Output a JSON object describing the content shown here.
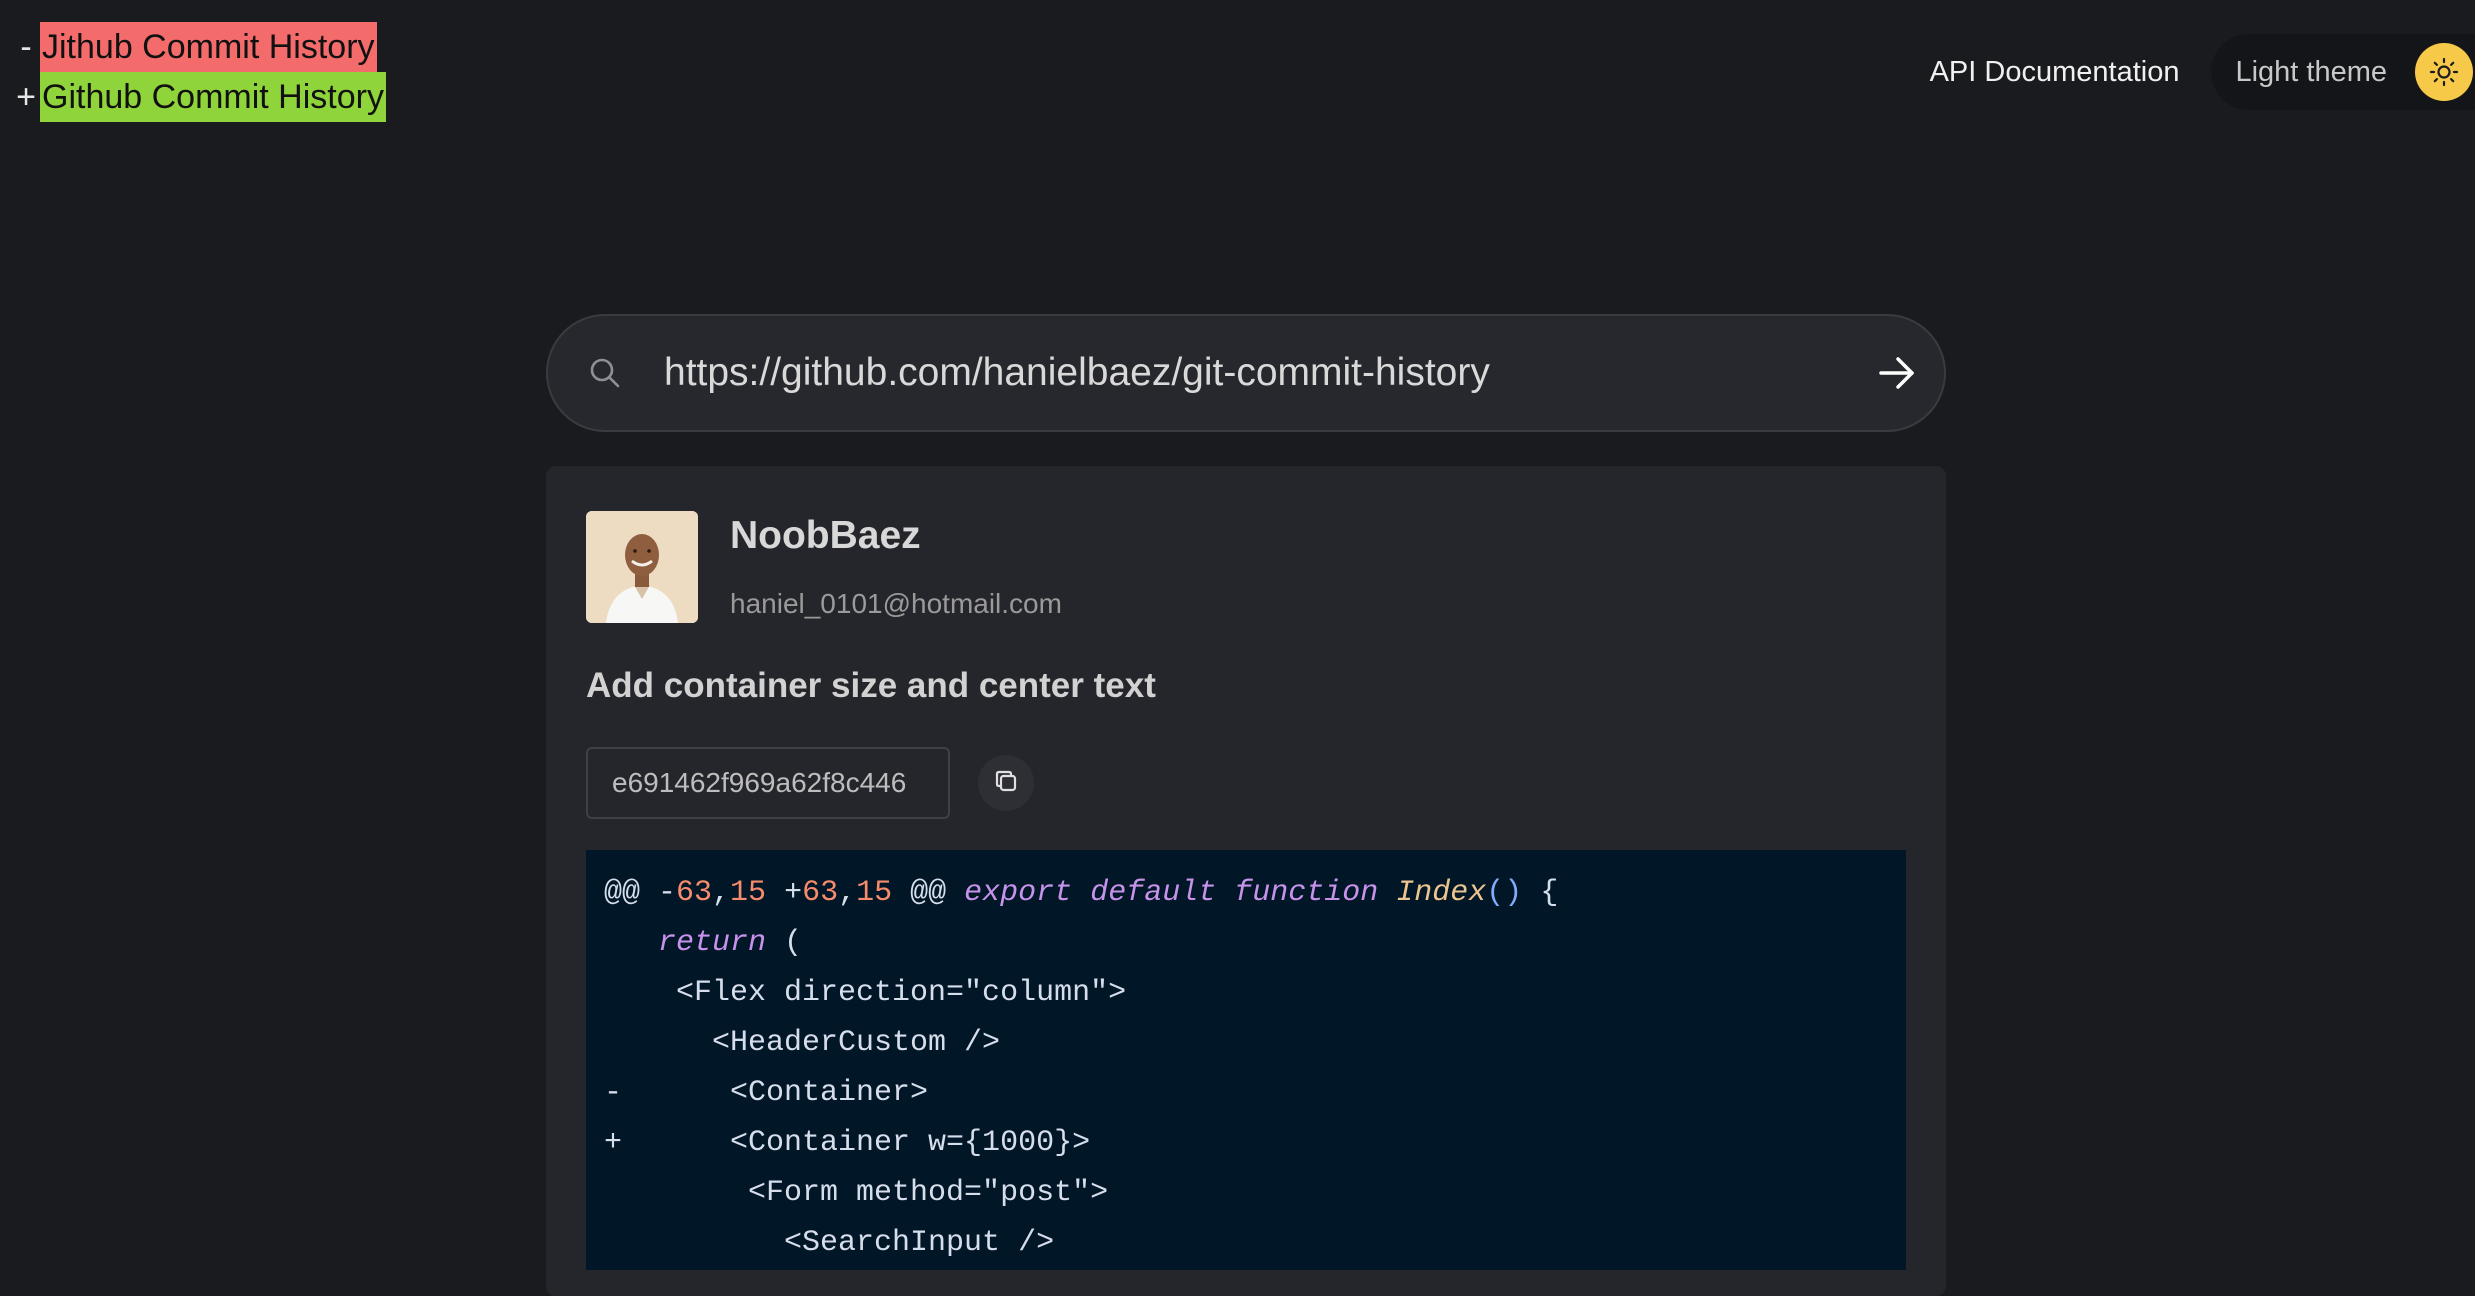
{
  "page_title": {
    "removed": "Jithub Commit History",
    "added": "Github Commit History",
    "minus_sign": "-",
    "plus_sign": "+"
  },
  "header": {
    "api_docs_label": "API Documentation",
    "theme_toggle_label": "Light theme",
    "theme_icon": "sun-icon"
  },
  "search": {
    "value": "https://github.com/hanielbaez/git-commit-history",
    "search_icon": "search-icon",
    "submit_icon": "arrow-right-icon"
  },
  "commit": {
    "author_name": "NoobBaez",
    "author_email": "haniel_0101@hotmail.com",
    "message": "Add container size and center text",
    "sha": "e691462f969a62f8c446",
    "copy_icon": "copy-icon",
    "diff": {
      "hunk_header": {
        "prefix": "@@ -",
        "old_start": "63",
        "comma1": ",",
        "old_len": "15",
        "mid": " +",
        "new_start": "63",
        "comma2": ",",
        "new_len": "15",
        "suffix": " @@ ",
        "kw_export": "export",
        "kw_default": "default",
        "kw_function": "function",
        "fn_name": "Index",
        "parens": "()",
        "brace": " {"
      },
      "return_kw": "return",
      "return_rest": " (",
      "lines": [
        "    <Flex direction=\"column\">",
        "      <HeaderCustom />",
        "-      <Container>",
        "+      <Container w={1000}>",
        "        <Form method=\"post\">",
        "          <SearchInput />"
      ]
    }
  },
  "colors": {
    "background": "#1a1b1f",
    "card": "#25262b",
    "code_bg": "#011627",
    "removed_highlight": "#f36b6b",
    "added_highlight": "#8fd43a",
    "sun_button": "#f7c948"
  }
}
